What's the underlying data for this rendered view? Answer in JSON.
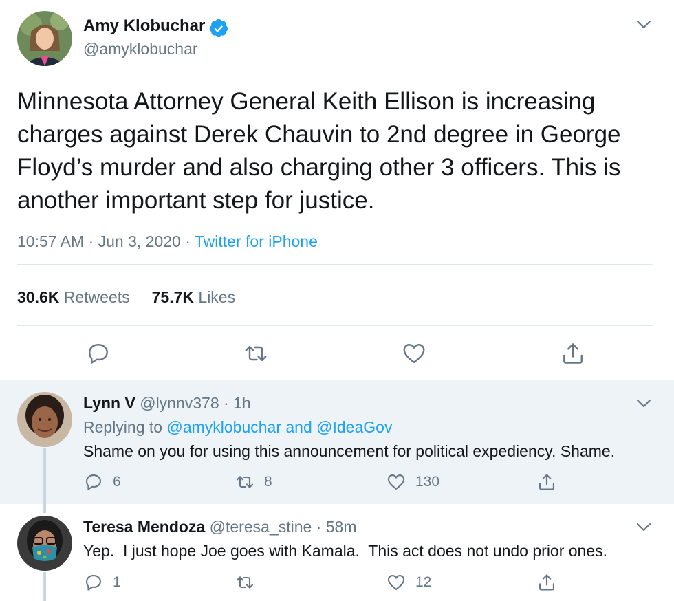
{
  "tweet": {
    "author_name": "Amy Klobuchar",
    "author_handle": "@amyklobuchar",
    "verified": true,
    "text": "Minnesota Attorney General Keith Ellison is increasing charges against Derek Chauvin to 2nd degree in George Floyd’s murder and also charging other 3 officers. This is another important step for justice.",
    "time": "10:57 AM",
    "date": "Jun 3, 2020",
    "source": "Twitter for iPhone",
    "retweets_count": "30.6K",
    "retweets_label": "Retweets",
    "likes_count": "75.7K",
    "likes_label": "Likes"
  },
  "replies": [
    {
      "name": "Lynn V",
      "handle": "@lynnv378",
      "time": "1h",
      "replying_prefix": "Replying to",
      "replying_to": "@amyklobuchar and @IdeaGov",
      "text": "Shame on you for using this announcement for political expediency. Shame.",
      "reply_count": "6",
      "retweet_count": "8",
      "like_count": "130"
    },
    {
      "name": "Teresa Mendoza",
      "handle": "@teresa_stine",
      "time": "58m",
      "text": "Yep.  I just hope Joe goes with Kamala.  This act does not undo prior ones.",
      "reply_count": "1",
      "retweet_count": "",
      "like_count": "12"
    }
  ],
  "separator": "·",
  "colors": {
    "accent": "#1da1f2",
    "secondary_text": "#657786",
    "primary_text": "#14171a",
    "highlight_bg": "#eef3f8",
    "divider": "#e1e8ed"
  },
  "icons": [
    "verified-badge-icon",
    "chevron-down-icon",
    "reply-icon",
    "retweet-icon",
    "like-icon",
    "share-icon"
  ]
}
